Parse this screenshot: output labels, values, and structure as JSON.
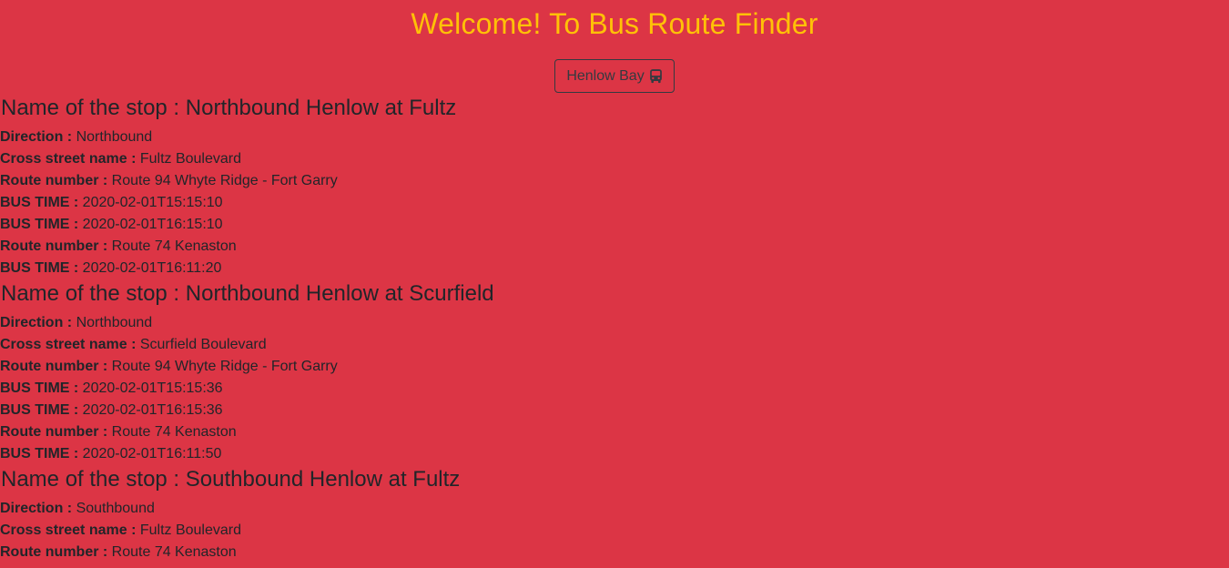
{
  "header": {
    "title": "Welcome! To Bus Route Finder"
  },
  "search": {
    "button_label": "Henlow Bay",
    "button_icon": "bus-icon"
  },
  "labels": {
    "stop_name": "Name of the stop : ",
    "direction": "Direction : ",
    "cross_street": "Cross street name : ",
    "route_number": "Route number : ",
    "bus_time": "BUS TIME : "
  },
  "stops": [
    {
      "name": "Northbound Henlow at Fultz",
      "direction": "Northbound",
      "cross_street": "Fultz Boulevard",
      "routes": [
        {
          "route": "Route 94 Whyte Ridge - Fort Garry",
          "times": [
            "2020-02-01T15:15:10",
            "2020-02-01T16:15:10"
          ]
        },
        {
          "route": "Route 74 Kenaston",
          "times": [
            "2020-02-01T16:11:20"
          ]
        }
      ]
    },
    {
      "name": "Northbound Henlow at Scurfield",
      "direction": "Northbound",
      "cross_street": "Scurfield Boulevard",
      "routes": [
        {
          "route": "Route 94 Whyte Ridge - Fort Garry",
          "times": [
            "2020-02-01T15:15:36",
            "2020-02-01T16:15:36"
          ]
        },
        {
          "route": "Route 74 Kenaston",
          "times": [
            "2020-02-01T16:11:50"
          ]
        }
      ]
    },
    {
      "name": "Southbound Henlow at Fultz",
      "direction": "Southbound",
      "cross_street": "Fultz Boulevard",
      "routes": [
        {
          "route": "Route 74 Kenaston",
          "times": []
        }
      ]
    }
  ],
  "colors": {
    "background": "#dc3545",
    "title": "#ffc107",
    "text": "#212529",
    "button_border": "#343a40"
  }
}
